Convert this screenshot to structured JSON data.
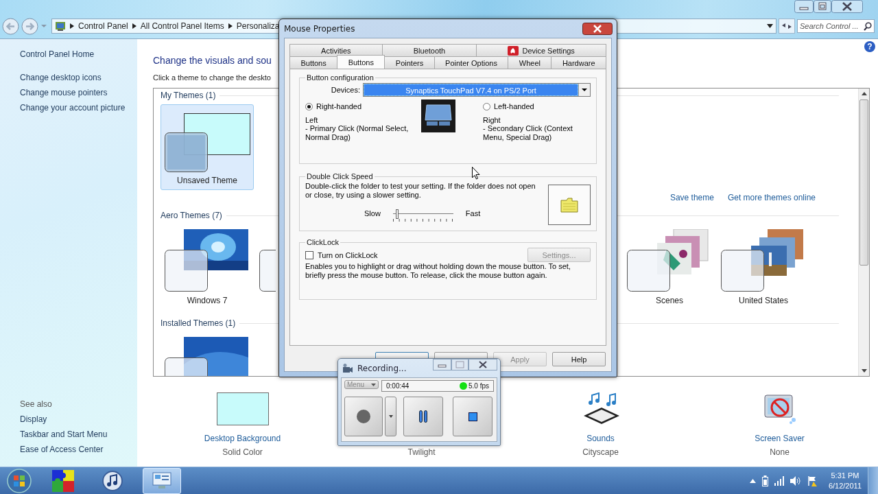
{
  "address_bar": {
    "crumbs": [
      "Control Panel",
      "All Control Panel Items",
      "Personaliza"
    ]
  },
  "search": {
    "placeholder": "Search Control ..."
  },
  "sidebar": {
    "links": [
      "Control Panel Home",
      "Change desktop icons",
      "Change mouse pointers",
      "Change your account picture"
    ],
    "see_also": {
      "title": "See also",
      "links": [
        "Display",
        "Taskbar and Start Menu",
        "Ease of Access Center"
      ]
    }
  },
  "main": {
    "help": "?",
    "heading": "Change the visuals and sou",
    "description": "Click a theme to change the deskto",
    "theme_groups": [
      {
        "title": "My Themes (1)",
        "themes": [
          {
            "kind": "solid",
            "name": "Unsaved Theme",
            "selected": true
          }
        ],
        "links": [
          "Save theme",
          "Get more themes online"
        ]
      },
      {
        "title": "Aero Themes (7)",
        "themes": [
          {
            "kind": "picture",
            "name": "Windows 7",
            "selected": false
          },
          {
            "kind": "picture",
            "selected": false
          },
          {
            "kind": "picture",
            "name": "Scenes",
            "selected": false
          },
          {
            "kind": "picture",
            "name": "United States",
            "selected": false
          }
        ]
      },
      {
        "title": "Installed Themes (1)",
        "themes": [
          {
            "kind": "picture",
            "selected": false
          }
        ]
      }
    ],
    "settings": [
      {
        "kind": "color-swatch",
        "label": "Desktop Background",
        "value": "Solid Color"
      },
      {
        "value": "Twilight"
      },
      {
        "kind": "sounds",
        "label": "Sounds",
        "value": "Cityscape"
      },
      {
        "kind": "screen-saver",
        "label": "Screen Saver",
        "value": "None"
      }
    ]
  },
  "mouse_dialog": {
    "title": "Mouse Properties",
    "tab_rows": [
      [
        {
          "label": "Activities",
          "selected": false
        },
        {
          "label": "Bluetooth",
          "selected": false
        },
        {
          "label": "Device Settings",
          "selected": false,
          "kind": "with-icon"
        }
      ],
      [
        {
          "label": "Buttons",
          "selected": false
        },
        {
          "label": "Buttons",
          "selected": true
        },
        {
          "label": "Pointers",
          "selected": false
        },
        {
          "label": "Pointer Options",
          "selected": false
        },
        {
          "label": "Wheel",
          "selected": false
        },
        {
          "label": "Hardware",
          "selected": false
        }
      ]
    ],
    "button_configuration": {
      "title": "Button configuration",
      "devices_label": "Devices:",
      "device": "Synaptics TouchPad V7.4 on PS/2 Port",
      "options": [
        {
          "label": "Right-handed",
          "selected": true,
          "button": "Left",
          "description": "- Primary Click (Normal Select, Normal Drag)"
        },
        {
          "label": "Left-handed",
          "selected": false,
          "button": "Right",
          "description": "- Secondary Click (Context Menu, Special Drag)"
        }
      ]
    },
    "double_click_speed": {
      "title": "Double Click Speed",
      "description": "Double-click the folder to test your setting.  If the folder does not open or close, try using a slower setting.",
      "slow_label": "Slow",
      "fast_label": "Fast",
      "level": 0.05
    },
    "clicklock": {
      "title": "ClickLock",
      "checkbox": {
        "label": "Turn on ClickLock",
        "checked": false
      },
      "settings_button": {
        "label": "Settings...",
        "disabled": true
      },
      "description": "Enables you to highlight or drag without holding down the mouse button.  To set, briefly press the mouse button.  To release, click the mouse button again."
    },
    "buttons": [
      {
        "label": "Apply",
        "disabled": true
      },
      {
        "label": "Help",
        "disabled": false
      }
    ]
  },
  "recorder": {
    "title": "Recording...",
    "menu": {
      "label": "Menu",
      "disabled": true
    },
    "elapsed": "0:00:44",
    "fps": "5.0 fps"
  },
  "taskbar": {
    "apps": [
      {
        "kind": "puzzle",
        "selected": false
      },
      {
        "kind": "music",
        "selected": false
      },
      {
        "kind": "control-panel",
        "selected": true
      }
    ],
    "time": "5:31 PM",
    "date": "6/12/2011"
  }
}
